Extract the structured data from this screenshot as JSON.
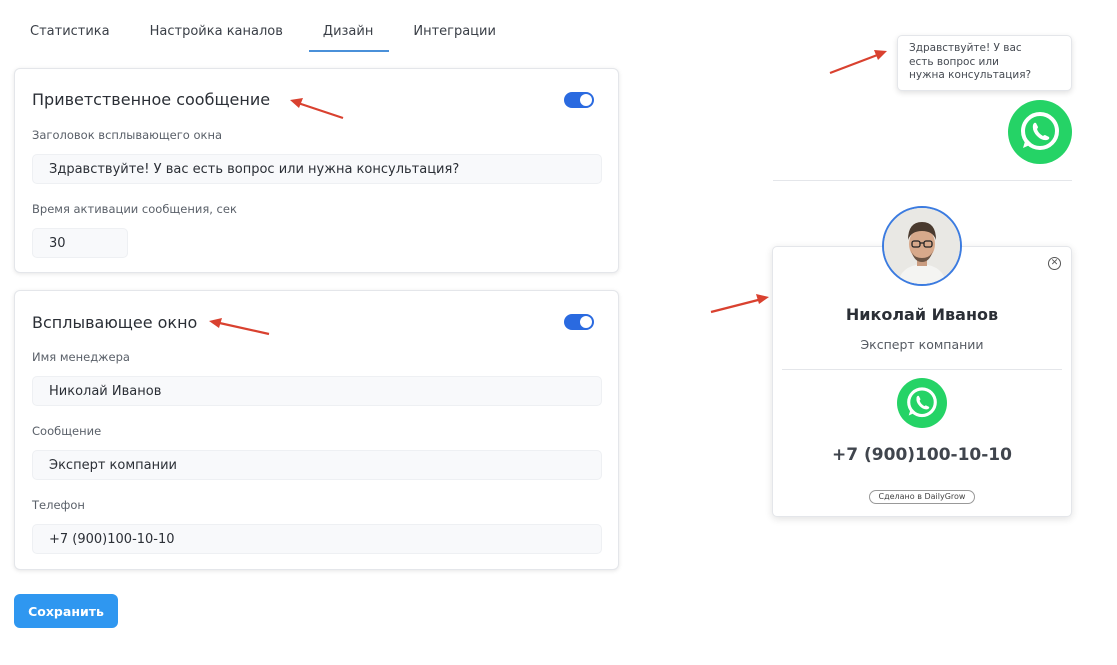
{
  "tabs": [
    {
      "label": "Статистика",
      "active": false
    },
    {
      "label": "Настройка каналов",
      "active": false
    },
    {
      "label": "Дизайн",
      "active": true
    },
    {
      "label": "Интеграции",
      "active": false
    }
  ],
  "welcome": {
    "title": "Приветственное сообщение",
    "enabled": true,
    "header_label": "Заголовок всплывающего окна",
    "header_value": "Здравствуйте! У вас есть вопрос или нужна консультация?",
    "time_label": "Время активации сообщения, сек",
    "time_value": "30"
  },
  "popup_settings": {
    "title": "Всплывающее окно",
    "enabled": true,
    "manager_label": "Имя менеджера",
    "manager_value": "Николай Иванов",
    "message_label": "Сообщение",
    "message_value": "Эксперт компании",
    "phone_label": "Телефон",
    "phone_value": "+7 (900)100-10-10"
  },
  "save_label": "Сохранить",
  "preview": {
    "bubble_line1": "Здравствуйте! У вас",
    "bubble_line2": "есть вопрос или",
    "bubble_line3": "нужна консультация?",
    "manager_name": "Николай Иванов",
    "manager_role": "Эксперт компании",
    "phone": "+7 (900)100-10-10",
    "made_by": "Сделано в DailyGrow",
    "close_glyph": "✕"
  },
  "icons": {
    "whatsapp": "whatsapp-icon",
    "close": "close-icon",
    "arrow": "arrow-annotation-icon"
  },
  "colors": {
    "accent": "#2a6ae0",
    "tab_underline": "#4a90d9",
    "save_button": "#2f97f0",
    "whatsapp": "#25d366",
    "arrow": "#d9412f"
  }
}
